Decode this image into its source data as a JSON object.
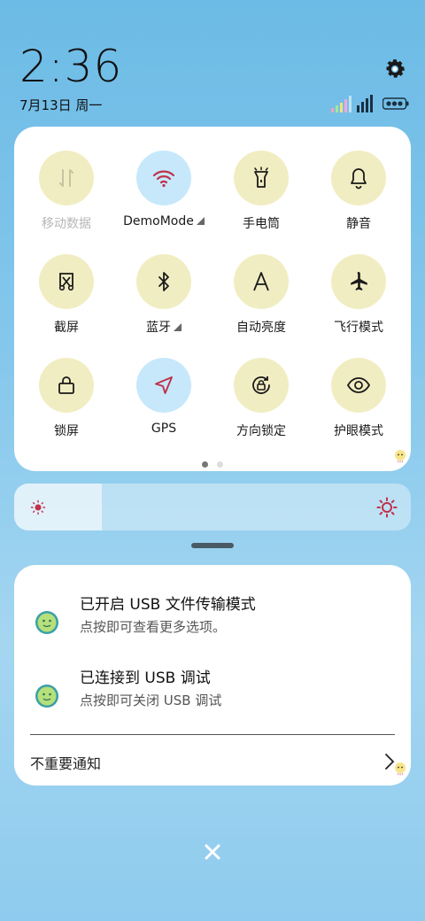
{
  "status": {
    "time": "2:36",
    "date": "7月13日 周一"
  },
  "quick_settings": {
    "tiles": [
      {
        "label": "移动数据",
        "icon": "mobile-data-icon",
        "state": "disabled"
      },
      {
        "label": "DemoMode",
        "icon": "wifi-icon",
        "state": "active",
        "has_menu": true
      },
      {
        "label": "手电筒",
        "icon": "flashlight-icon",
        "state": "off"
      },
      {
        "label": "静音",
        "icon": "bell-icon",
        "state": "off"
      },
      {
        "label": "截屏",
        "icon": "screenshot-icon",
        "state": "off"
      },
      {
        "label": "蓝牙",
        "icon": "bluetooth-icon",
        "state": "off",
        "has_menu": true
      },
      {
        "label": "自动亮度",
        "icon": "auto-brightness-icon",
        "state": "off"
      },
      {
        "label": "飞行模式",
        "icon": "airplane-icon",
        "state": "off"
      },
      {
        "label": "锁屏",
        "icon": "lock-icon",
        "state": "off"
      },
      {
        "label": "GPS",
        "icon": "gps-icon",
        "state": "active"
      },
      {
        "label": "方向锁定",
        "icon": "rotation-lock-icon",
        "state": "off"
      },
      {
        "label": "护眼模式",
        "icon": "eye-icon",
        "state": "off"
      }
    ],
    "page_count": 2,
    "current_page": 1
  },
  "brightness": {
    "level": 0.22
  },
  "notifications": [
    {
      "title": "已开启 USB 文件传输模式",
      "body": "点按即可查看更多选项。",
      "icon": "android-debug-icon"
    },
    {
      "title": "已连接到 USB 调试",
      "body": "点按即可关闭 USB 调试",
      "icon": "android-debug-icon"
    }
  ],
  "unimportant_label": "不重要通知",
  "colors": {
    "tile_off": "#f1edc2",
    "tile_on": "#c7e8fb",
    "accent_red": "#c0304a"
  }
}
